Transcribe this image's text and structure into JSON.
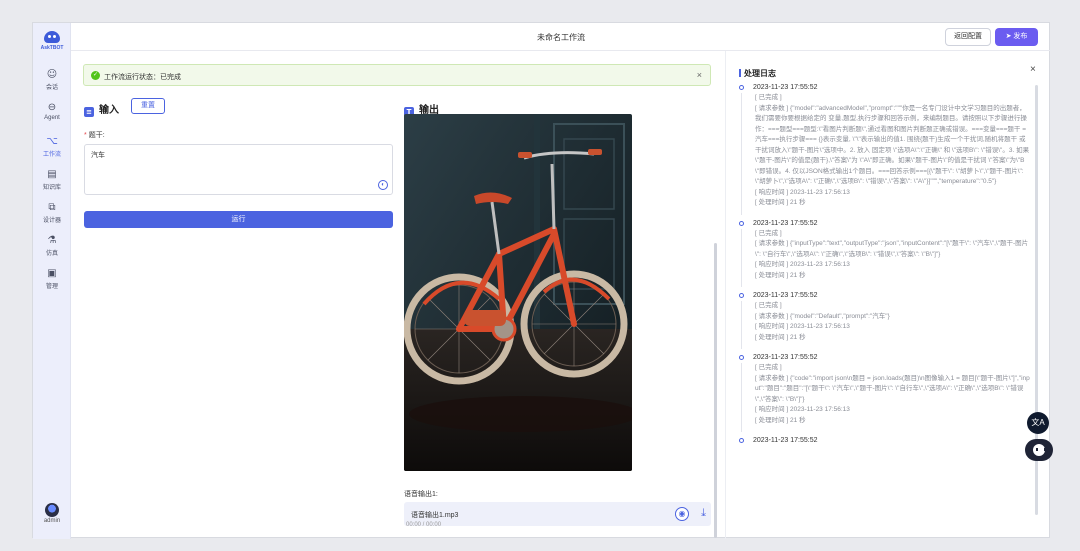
{
  "sidebar": {
    "logo_text": "AskTBOT",
    "items": [
      {
        "label": "会话",
        "icon": "chat-icon"
      },
      {
        "label": "Agent",
        "icon": "agent-icon"
      },
      {
        "label": "工作流",
        "icon": "workflow-icon"
      },
      {
        "label": "知识库",
        "icon": "knowledge-icon"
      },
      {
        "label": "设计器",
        "icon": "designer-icon"
      },
      {
        "label": "仿真",
        "icon": "flask-icon"
      },
      {
        "label": "管理",
        "icon": "admin-icon"
      }
    ],
    "active_item": "工作流",
    "user_label": "admin"
  },
  "header": {
    "title": "未命名工作流",
    "back_button": "返回配置",
    "publish_button": "发布"
  },
  "status": {
    "text": "工作流运行状态：已完成",
    "color": "#52c41a"
  },
  "input": {
    "title": "输入",
    "reset_button": "重置",
    "field_label": "题干:",
    "field_value": "汽车",
    "run_button": "运行"
  },
  "output": {
    "title": "输出",
    "image_desc": "red bicycle",
    "voice_label": "语音输出1:",
    "audio_file": "语音输出1.mp3",
    "audio_sub": "00:00 / 00:00"
  },
  "log": {
    "title": "处理日志",
    "entries": [
      {
        "time": "2023-11-23 17:55:52",
        "lines": [
          "[ 已完成 ]",
          "[ 请求参数 ] {\"model\":\"advancedModel\",\"prompt\":\"\"\"你是一名专门设计中文学习题目的出题者，我们需要你要根据给定的 变量,题型,执行步骤和回答示例，来编制题目。请按照以下步骤进行操作：===题型===题型:\\\"看图片判断题\\\",通过看图和图片判断题正确或错误。===变量===题干 = 汽车===执行步骤=== {}表示变量, \\\"\\\"表示输出的值1. 围绕{题干}生成一个干扰词,随机将题干 或 干扰词放入\\\"题干-图片\\\"选项中。2. 放入 固定项 \\\"选项A\\\":\\\"正确\\\" 和 \\\"选项B\\\": \\\"错误\\\"。3. 如果\\\"题干-图片\\\"的值是{题干},\\\"答案\\\"为 \\\"A\\\"即正确。如果\\\"题干-图片\\\"的值是干扰词 \\\"答案\\\"为\\\"B\\\"即错误。4. 仅以JSON格式输出1个题目。===回答示例===[{\\\"题干\\\": \\\"胡萝卜\\\",\\\"题干-图片\\\": \\\"胡萝卜\\\",\\\"选项A\\\": \\\"正确\\\",\\\"选项B\\\": \\\"错误\\\",\\\"答案\\\": \\\"A\\\"}]\"\"\",\"temperature\":\"0.5\"}",
          "[ 响应时间 ] 2023-11-23 17:56:13",
          "[ 处理时间 ] 21 秒"
        ]
      },
      {
        "time": "2023-11-23 17:55:52",
        "lines": [
          "[ 已完成 ]",
          "[ 请求参数 ] {\"inputType\":\"text\",\"outputType\":\"json\",\"inputContent\":\"[\\\"题干\\\": \\\"汽车\\\",\\\"题干-图片\\\": \\\"自行车\\\",\\\"选项A\\\": \\\"正确\\\",\\\"选项B\\\": \\\"错误\\\",\\\"答案\\\": \\\"B\\\"]\"}",
          "[ 响应时间 ] 2023-11-23 17:56:13",
          "[ 处理时间 ] 21 秒"
        ]
      },
      {
        "time": "2023-11-23 17:55:52",
        "lines": [
          "[ 已完成 ]",
          "[ 请求参数 ] {\"model\":\"Default\",\"prompt\":\"汽车\"}",
          "[ 响应时间 ] 2023-11-23 17:56:13",
          "[ 处理时间 ] 21 秒"
        ]
      },
      {
        "time": "2023-11-23 17:55:52",
        "lines": [
          "[ 已完成 ]",
          "[ 请求参数 ] {\"code\":\"import json\\n题目 = json.loads(题目)\\n图像输入1 = 题目[\\\"题干-图片\\\"]\",\"input\":\"题目\":\"题目\":\"[\\\"题干\\\": \\\"汽车\\\",\\\"题干-图片\\\": \\\"自行车\\\",\\\"选项A\\\": \\\"正确\\\",\\\"选项B\\\": \\\"错误\\\",\\\"答案\\\": \\\"B\\\"]\"}",
          "[ 响应时间 ] 2023-11-23 17:56:13",
          "[ 处理时间 ] 21 秒"
        ]
      },
      {
        "time": "2023-11-23 17:55:52",
        "lines": []
      }
    ]
  },
  "colors": {
    "accent": "#4b63e0",
    "publish": "#6b5cf0",
    "sidebar_bg": "#eceefb"
  }
}
